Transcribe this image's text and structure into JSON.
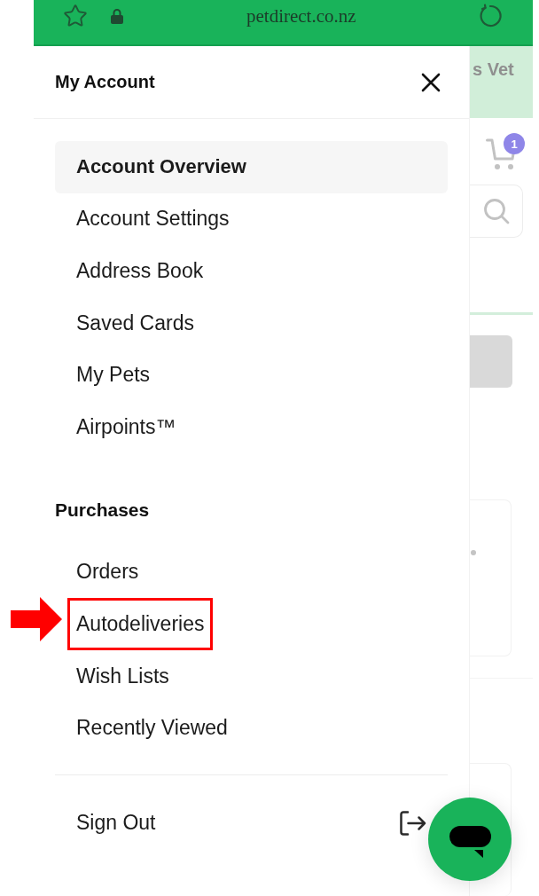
{
  "browser_bar": {
    "url": "petdirect.co.nz"
  },
  "drawer": {
    "title": "My Account",
    "account_items": [
      {
        "label": "Account Overview",
        "selected": true,
        "annotated": false
      },
      {
        "label": "Account Settings",
        "selected": false,
        "annotated": false
      },
      {
        "label": "Address Book",
        "selected": false,
        "annotated": false
      },
      {
        "label": "Saved Cards",
        "selected": false,
        "annotated": false
      },
      {
        "label": "My Pets",
        "selected": false,
        "annotated": false
      },
      {
        "label": "Airpoints™",
        "selected": false,
        "annotated": false
      }
    ],
    "purchases_heading": "Purchases",
    "purchase_items": [
      {
        "label": "Orders",
        "selected": false,
        "annotated": false
      },
      {
        "label": "Autodeliveries",
        "selected": false,
        "annotated": true
      },
      {
        "label": "Wish Lists",
        "selected": false,
        "annotated": false
      },
      {
        "label": "Recently Viewed",
        "selected": false,
        "annotated": false
      }
    ],
    "sign_out": "Sign Out"
  },
  "background_page": {
    "banner_text": "s Vet",
    "cart_count": "1"
  }
}
